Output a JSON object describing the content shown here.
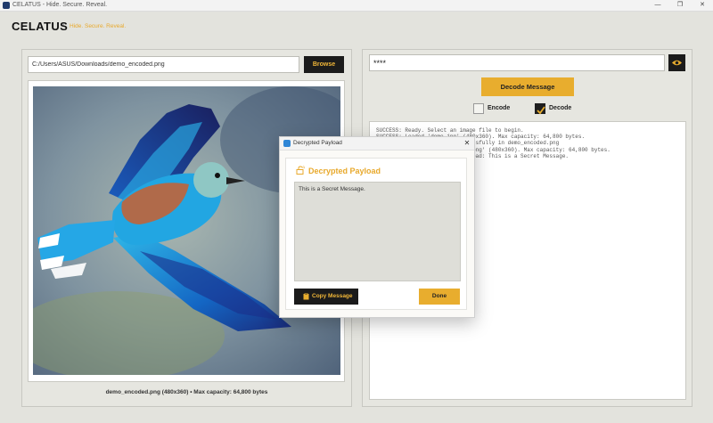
{
  "window": {
    "title": "CELATUS - Hide. Secure. Reveal.",
    "minimize": "—",
    "maximize": "❐",
    "close": "✕"
  },
  "header": {
    "title": "CELATUS",
    "separator": "•",
    "tagline": "Hide. Secure. Reveal."
  },
  "left": {
    "path_value": "C:/Users/ASUS/Downloads/demo_encoded.png",
    "browse_label": "Browse",
    "caption": "demo_encoded.png (480x360) • Max capacity: 64,800 bytes"
  },
  "right": {
    "password_value": "****",
    "decode_label": "Decode Message",
    "encode_option": "Encode",
    "decode_option": "Decode",
    "selected_mode": "Decode",
    "log_lines": [
      "SUCCESS: Ready. Select an image file to begin.",
      "SUCCESS: Loaded 'demo.jpg' (480x360). Max capacity: 64,800 bytes.",
      "SUCCESS: Message encoded successfully in demo_encoded.png",
      "",
      "SUCCESS: Loaded 'demo_encoded.png' (480x360). Max capacity: 64,800 bytes.",
      "SUCCESS: Message decoded. Payload: This is a Secret Message."
    ]
  },
  "dialog": {
    "title": "Decrypted Payload",
    "heading": "Decrypted Payload",
    "message": "This is a Secret Message.",
    "copy_label": "Copy Message",
    "done_label": "Done"
  },
  "colors": {
    "accent": "#e8ad2e",
    "dark": "#1b1b1b",
    "panel": "#e6e6e0"
  }
}
